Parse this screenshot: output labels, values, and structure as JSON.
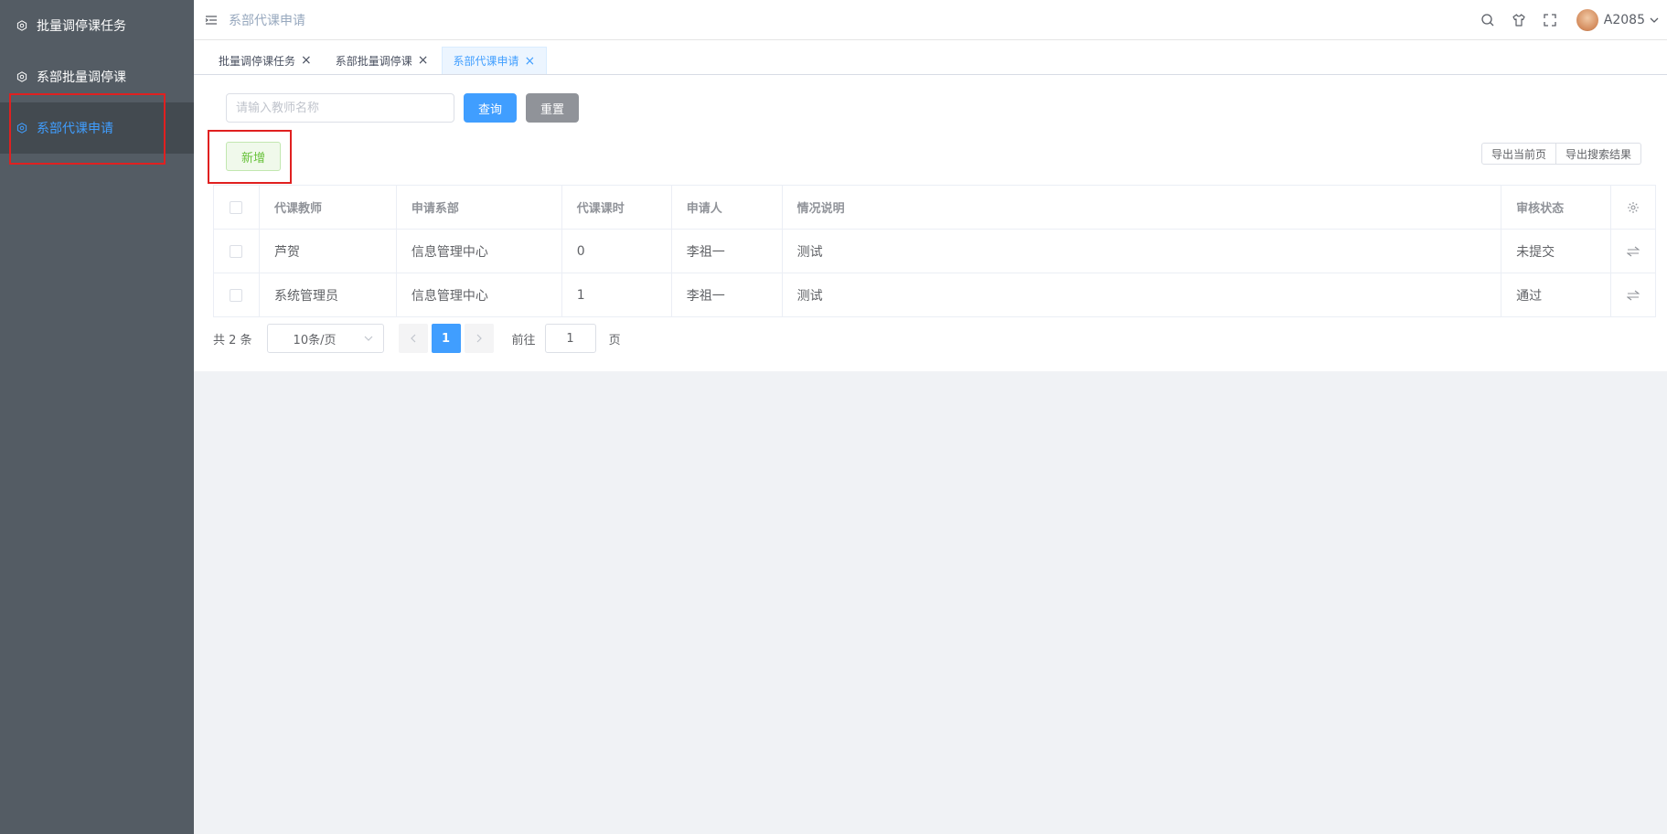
{
  "sidebar": {
    "items": [
      {
        "label": "批量调停课任务",
        "icon": "settings-icon"
      },
      {
        "label": "系部批量调停课",
        "icon": "settings-icon"
      },
      {
        "label": "系部代课申请",
        "icon": "settings-icon",
        "active": true
      }
    ]
  },
  "header": {
    "breadcrumb": "系部代课申请",
    "username": "A2085"
  },
  "tabs": [
    {
      "label": "批量调停课任务"
    },
    {
      "label": "系部批量调停课"
    },
    {
      "label": "系部代课申请",
      "active": true
    }
  ],
  "search": {
    "placeholder": "请输入教师名称",
    "query_label": "查询",
    "reset_label": "重置"
  },
  "toolbar": {
    "add_label": "新增",
    "export_page_label": "导出当前页",
    "export_search_label": "导出搜索结果"
  },
  "table": {
    "columns": [
      "代课教师",
      "申请系部",
      "代课课时",
      "申请人",
      "情况说明",
      "审核状态"
    ],
    "rows": [
      [
        "芦贺",
        "信息管理中心",
        "0",
        "李祖一",
        "测试",
        "未提交"
      ],
      [
        "系统管理员",
        "信息管理中心",
        "1",
        "李祖一",
        "测试",
        "通过"
      ]
    ]
  },
  "pagination": {
    "total_text": "共 2 条",
    "page_size": "10条/页",
    "current_page": "1",
    "goto_prefix": "前往",
    "goto_value": "1",
    "goto_suffix": "页"
  },
  "colors": {
    "primary": "#409eff",
    "sidebar_bg": "#545c64",
    "success": "#67c23a",
    "highlight_box": "#e02020"
  }
}
